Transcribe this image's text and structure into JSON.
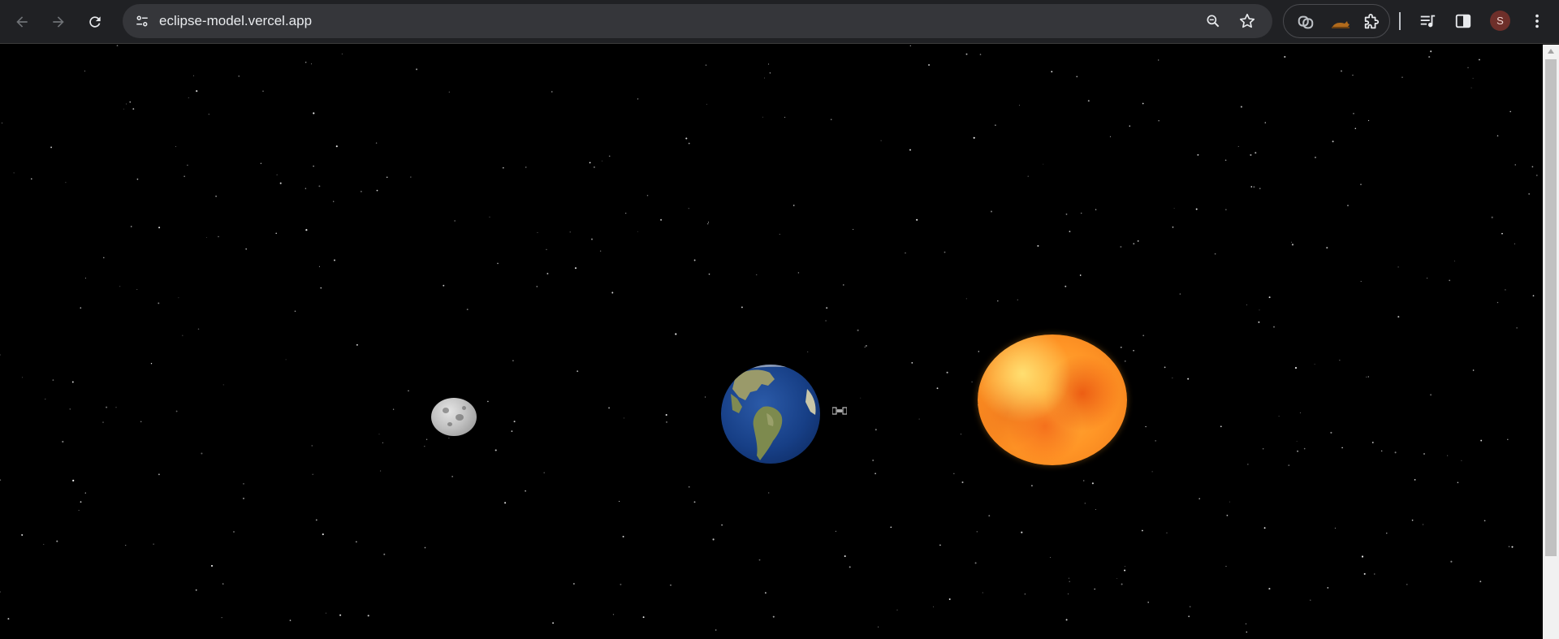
{
  "browser": {
    "url": "eclipse-model.vercel.app",
    "profile_initial": "S",
    "icons": {
      "back": "arrow-left-icon",
      "forward": "arrow-right-icon",
      "reload": "reload-icon",
      "site_info": "tune-icon",
      "zoom": "zoom-icon",
      "bookmark": "star-icon",
      "extension_1": "extension-logo-icon",
      "extension_2": "extension-cat-icon",
      "extensions": "puzzle-icon",
      "media": "media-controls-icon",
      "side_panel": "side-panel-icon",
      "menu": "kebab-menu-icon"
    }
  },
  "scene": {
    "bodies": [
      "moon",
      "earth",
      "satellite",
      "sun"
    ],
    "colors": {
      "background": "#000000",
      "sun": "#ff9526",
      "earth": "#173f86",
      "moon": "#c2c2c2"
    }
  }
}
